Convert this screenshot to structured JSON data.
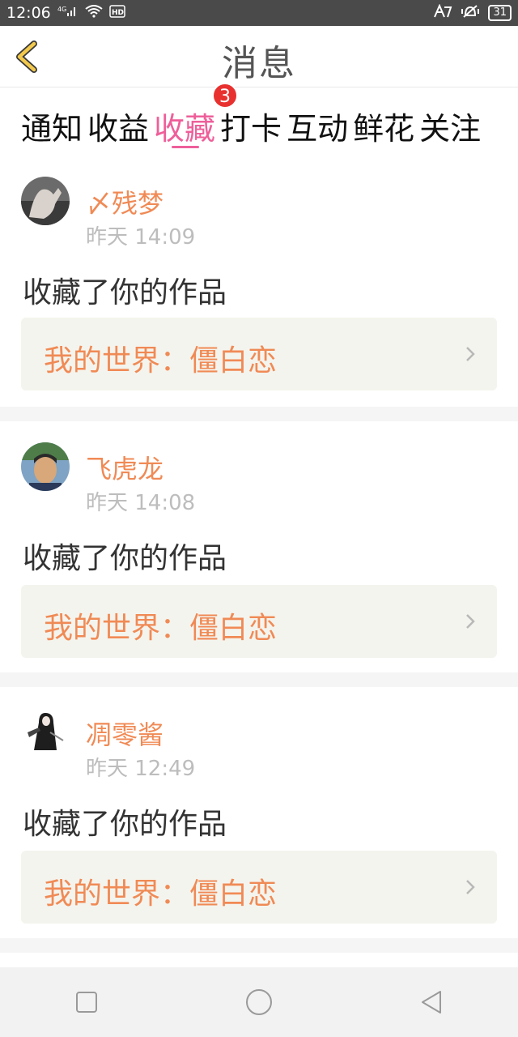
{
  "status_bar": {
    "time": "12:06",
    "network": "4G",
    "hd": "HD",
    "battery": "31"
  },
  "header": {
    "title": "消息"
  },
  "tabs": [
    {
      "label": "通知"
    },
    {
      "label": "收益"
    },
    {
      "label": "收藏",
      "active": true,
      "badge": "3"
    },
    {
      "label": "打卡"
    },
    {
      "label": "互动"
    },
    {
      "label": "鲜花"
    },
    {
      "label": "关注"
    }
  ],
  "messages": [
    {
      "user": "〆残梦",
      "time": "昨天 14:09",
      "action": "收藏了你的作品",
      "work": "我的世界：僵白恋",
      "avatar": "avatar-hand"
    },
    {
      "user": "飞虎龙",
      "time": "昨天 14:08",
      "action": "收藏了你的作品",
      "work": "我的世界：僵白恋",
      "avatar": "avatar-face"
    },
    {
      "user": "凋零酱",
      "time": "昨天 12:49",
      "action": "收藏了你的作品",
      "work": "我的世界：僵白恋",
      "avatar": "avatar-anime"
    }
  ],
  "colors": {
    "accent": "#ee5f9a",
    "username": "#f08a55",
    "badge": "#e8312f",
    "back_arrow": "#f2c94c"
  }
}
